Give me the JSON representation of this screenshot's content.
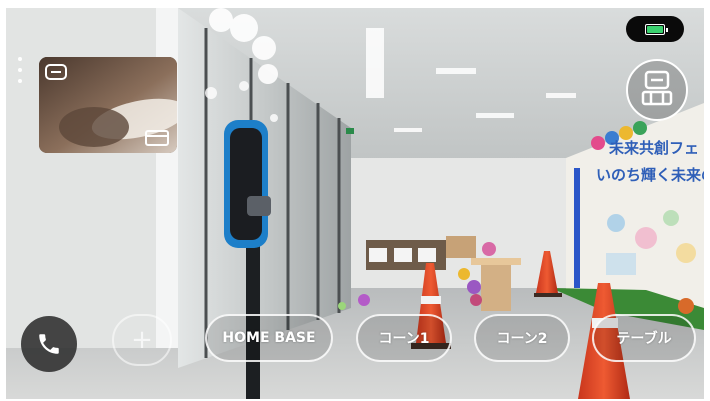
{
  "app": {
    "title": "Telepresence robot camera view"
  },
  "status": {
    "battery_icon": "battery-icon",
    "battery_color": "#3bd16f"
  },
  "camera": {
    "scene": "Office lobby with glass partitions, traffic cones, balloons and a colorful mural",
    "mural_line1": "未来共創フェ",
    "mural_line2": "いのち輝く未来のき"
  },
  "controls": {
    "menu_icon": "more-vertical-icon",
    "pip_minimize_icon": "minimize-icon",
    "pip_expand_icon": "expand-icon",
    "robot_icon": "robot-icon",
    "call_icon": "phone-icon",
    "add_icon": "plus-icon",
    "locations": [
      {
        "label": "HOME BASE"
      },
      {
        "label": "コーン1"
      },
      {
        "label": "コーン2"
      },
      {
        "label": "テーブル"
      }
    ]
  }
}
